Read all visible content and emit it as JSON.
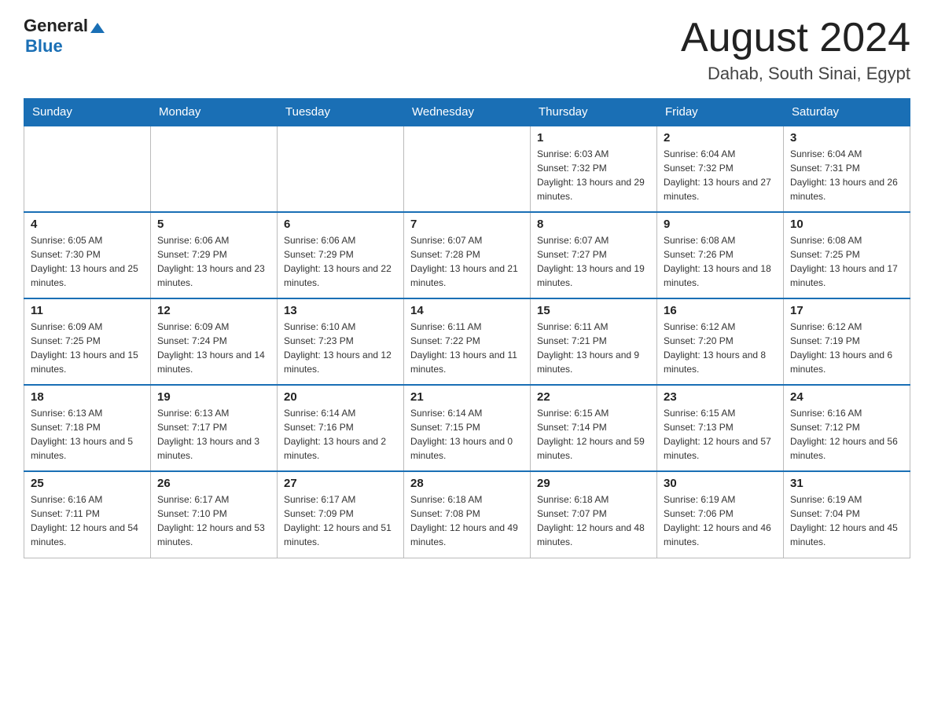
{
  "header": {
    "logo_general": "General",
    "logo_blue": "Blue",
    "main_title": "August 2024",
    "subtitle": "Dahab, South Sinai, Egypt"
  },
  "weekdays": [
    "Sunday",
    "Monday",
    "Tuesday",
    "Wednesday",
    "Thursday",
    "Friday",
    "Saturday"
  ],
  "weeks": [
    [
      {
        "day": "",
        "sunrise": "",
        "sunset": "",
        "daylight": ""
      },
      {
        "day": "",
        "sunrise": "",
        "sunset": "",
        "daylight": ""
      },
      {
        "day": "",
        "sunrise": "",
        "sunset": "",
        "daylight": ""
      },
      {
        "day": "",
        "sunrise": "",
        "sunset": "",
        "daylight": ""
      },
      {
        "day": "1",
        "sunrise": "Sunrise: 6:03 AM",
        "sunset": "Sunset: 7:32 PM",
        "daylight": "Daylight: 13 hours and 29 minutes."
      },
      {
        "day": "2",
        "sunrise": "Sunrise: 6:04 AM",
        "sunset": "Sunset: 7:32 PM",
        "daylight": "Daylight: 13 hours and 27 minutes."
      },
      {
        "day": "3",
        "sunrise": "Sunrise: 6:04 AM",
        "sunset": "Sunset: 7:31 PM",
        "daylight": "Daylight: 13 hours and 26 minutes."
      }
    ],
    [
      {
        "day": "4",
        "sunrise": "Sunrise: 6:05 AM",
        "sunset": "Sunset: 7:30 PM",
        "daylight": "Daylight: 13 hours and 25 minutes."
      },
      {
        "day": "5",
        "sunrise": "Sunrise: 6:06 AM",
        "sunset": "Sunset: 7:29 PM",
        "daylight": "Daylight: 13 hours and 23 minutes."
      },
      {
        "day": "6",
        "sunrise": "Sunrise: 6:06 AM",
        "sunset": "Sunset: 7:29 PM",
        "daylight": "Daylight: 13 hours and 22 minutes."
      },
      {
        "day": "7",
        "sunrise": "Sunrise: 6:07 AM",
        "sunset": "Sunset: 7:28 PM",
        "daylight": "Daylight: 13 hours and 21 minutes."
      },
      {
        "day": "8",
        "sunrise": "Sunrise: 6:07 AM",
        "sunset": "Sunset: 7:27 PM",
        "daylight": "Daylight: 13 hours and 19 minutes."
      },
      {
        "day": "9",
        "sunrise": "Sunrise: 6:08 AM",
        "sunset": "Sunset: 7:26 PM",
        "daylight": "Daylight: 13 hours and 18 minutes."
      },
      {
        "day": "10",
        "sunrise": "Sunrise: 6:08 AM",
        "sunset": "Sunset: 7:25 PM",
        "daylight": "Daylight: 13 hours and 17 minutes."
      }
    ],
    [
      {
        "day": "11",
        "sunrise": "Sunrise: 6:09 AM",
        "sunset": "Sunset: 7:25 PM",
        "daylight": "Daylight: 13 hours and 15 minutes."
      },
      {
        "day": "12",
        "sunrise": "Sunrise: 6:09 AM",
        "sunset": "Sunset: 7:24 PM",
        "daylight": "Daylight: 13 hours and 14 minutes."
      },
      {
        "day": "13",
        "sunrise": "Sunrise: 6:10 AM",
        "sunset": "Sunset: 7:23 PM",
        "daylight": "Daylight: 13 hours and 12 minutes."
      },
      {
        "day": "14",
        "sunrise": "Sunrise: 6:11 AM",
        "sunset": "Sunset: 7:22 PM",
        "daylight": "Daylight: 13 hours and 11 minutes."
      },
      {
        "day": "15",
        "sunrise": "Sunrise: 6:11 AM",
        "sunset": "Sunset: 7:21 PM",
        "daylight": "Daylight: 13 hours and 9 minutes."
      },
      {
        "day": "16",
        "sunrise": "Sunrise: 6:12 AM",
        "sunset": "Sunset: 7:20 PM",
        "daylight": "Daylight: 13 hours and 8 minutes."
      },
      {
        "day": "17",
        "sunrise": "Sunrise: 6:12 AM",
        "sunset": "Sunset: 7:19 PM",
        "daylight": "Daylight: 13 hours and 6 minutes."
      }
    ],
    [
      {
        "day": "18",
        "sunrise": "Sunrise: 6:13 AM",
        "sunset": "Sunset: 7:18 PM",
        "daylight": "Daylight: 13 hours and 5 minutes."
      },
      {
        "day": "19",
        "sunrise": "Sunrise: 6:13 AM",
        "sunset": "Sunset: 7:17 PM",
        "daylight": "Daylight: 13 hours and 3 minutes."
      },
      {
        "day": "20",
        "sunrise": "Sunrise: 6:14 AM",
        "sunset": "Sunset: 7:16 PM",
        "daylight": "Daylight: 13 hours and 2 minutes."
      },
      {
        "day": "21",
        "sunrise": "Sunrise: 6:14 AM",
        "sunset": "Sunset: 7:15 PM",
        "daylight": "Daylight: 13 hours and 0 minutes."
      },
      {
        "day": "22",
        "sunrise": "Sunrise: 6:15 AM",
        "sunset": "Sunset: 7:14 PM",
        "daylight": "Daylight: 12 hours and 59 minutes."
      },
      {
        "day": "23",
        "sunrise": "Sunrise: 6:15 AM",
        "sunset": "Sunset: 7:13 PM",
        "daylight": "Daylight: 12 hours and 57 minutes."
      },
      {
        "day": "24",
        "sunrise": "Sunrise: 6:16 AM",
        "sunset": "Sunset: 7:12 PM",
        "daylight": "Daylight: 12 hours and 56 minutes."
      }
    ],
    [
      {
        "day": "25",
        "sunrise": "Sunrise: 6:16 AM",
        "sunset": "Sunset: 7:11 PM",
        "daylight": "Daylight: 12 hours and 54 minutes."
      },
      {
        "day": "26",
        "sunrise": "Sunrise: 6:17 AM",
        "sunset": "Sunset: 7:10 PM",
        "daylight": "Daylight: 12 hours and 53 minutes."
      },
      {
        "day": "27",
        "sunrise": "Sunrise: 6:17 AM",
        "sunset": "Sunset: 7:09 PM",
        "daylight": "Daylight: 12 hours and 51 minutes."
      },
      {
        "day": "28",
        "sunrise": "Sunrise: 6:18 AM",
        "sunset": "Sunset: 7:08 PM",
        "daylight": "Daylight: 12 hours and 49 minutes."
      },
      {
        "day": "29",
        "sunrise": "Sunrise: 6:18 AM",
        "sunset": "Sunset: 7:07 PM",
        "daylight": "Daylight: 12 hours and 48 minutes."
      },
      {
        "day": "30",
        "sunrise": "Sunrise: 6:19 AM",
        "sunset": "Sunset: 7:06 PM",
        "daylight": "Daylight: 12 hours and 46 minutes."
      },
      {
        "day": "31",
        "sunrise": "Sunrise: 6:19 AM",
        "sunset": "Sunset: 7:04 PM",
        "daylight": "Daylight: 12 hours and 45 minutes."
      }
    ]
  ]
}
